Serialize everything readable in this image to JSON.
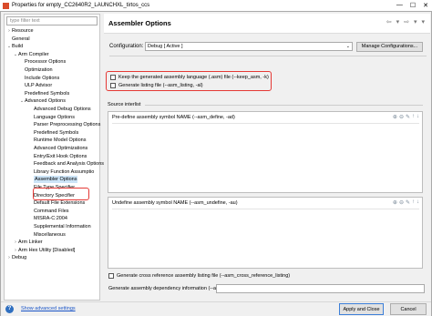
{
  "window": {
    "title": "Properties for empty_CC2640R2_LAUNCHXL_tirtos_ccs",
    "minimize": "—",
    "maximize": "☐",
    "close": "✕"
  },
  "filter": {
    "placeholder": "type filter text"
  },
  "tree": [
    {
      "label": "Resource",
      "twisty": "›",
      "level": 0
    },
    {
      "label": "General",
      "twisty": "",
      "level": 0
    },
    {
      "label": "Build",
      "twisty": "⌄",
      "level": 0
    },
    {
      "label": "Arm Compiler",
      "twisty": "⌄",
      "level": 1
    },
    {
      "label": "Processor Options",
      "twisty": "",
      "level": 2
    },
    {
      "label": "Optimization",
      "twisty": "",
      "level": 2
    },
    {
      "label": "Include Options",
      "twisty": "",
      "level": 2
    },
    {
      "label": "ULP Advisor",
      "twisty": "",
      "level": 2
    },
    {
      "label": "Predefined Symbols",
      "twisty": "",
      "level": 2
    },
    {
      "label": "Advanced Options",
      "twisty": "⌄",
      "level": 2
    },
    {
      "label": "Advanced Debug Options",
      "twisty": "",
      "level": 3
    },
    {
      "label": "Language Options",
      "twisty": "",
      "level": 3
    },
    {
      "label": "Parser Preprocessing Options",
      "twisty": "",
      "level": 3
    },
    {
      "label": "Predefined Symbols",
      "twisty": "",
      "level": 3
    },
    {
      "label": "Runtime Model Options",
      "twisty": "",
      "level": 3
    },
    {
      "label": "Advanced Optimizations",
      "twisty": "",
      "level": 3
    },
    {
      "label": "Entry/Exit Hook Options",
      "twisty": "",
      "level": 3
    },
    {
      "label": "Feedback and Analysis Options",
      "twisty": "",
      "level": 3
    },
    {
      "label": "Library Function Assumptio",
      "twisty": "",
      "level": 3
    },
    {
      "label": "Assembler Options",
      "twisty": "",
      "level": 3,
      "selected": true
    },
    {
      "label": "File Type Specifier",
      "twisty": "",
      "level": 3
    },
    {
      "label": "Directory Specifier",
      "twisty": "",
      "level": 3
    },
    {
      "label": "Default File Extensions",
      "twisty": "",
      "level": 3
    },
    {
      "label": "Command Files",
      "twisty": "",
      "level": 3
    },
    {
      "label": "MISRA-C:2004",
      "twisty": "",
      "level": 3
    },
    {
      "label": "Supplemental Information",
      "twisty": "",
      "level": 3
    },
    {
      "label": "Miscellaneous",
      "twisty": "",
      "level": 3
    },
    {
      "label": "Arm Linker",
      "twisty": "›",
      "level": 1
    },
    {
      "label": "Arm Hex Utility  [Disabled]",
      "twisty": "›",
      "level": 1
    },
    {
      "label": "Debug",
      "twisty": "›",
      "level": 0
    }
  ],
  "page": {
    "title": "Assembler Options",
    "nav_back": "⇦",
    "nav_menu": "▾",
    "nav_forward": "⇨",
    "nav_more": "▾",
    "nav_more2": "▾"
  },
  "configuration": {
    "label": "Configuration:",
    "value": "Debug  [ Active ]",
    "manage_label": "Manage Configurations..."
  },
  "options": {
    "keep_asm": "Keep the generated assembly language (.asm) file (--keep_asm, -k)",
    "gen_listing": "Generate listing file (--asm_listing, -al)",
    "source_interlist": "Source interlist",
    "predefine_header": "Pre-define assembly symbol NAME (--asm_define, -ad)",
    "undefine_header": "Undefine assembly symbol NAME (--asm_undefine, -au)",
    "cross_ref": "Generate cross reference assembly listing file (--asm_cross_reference_listing)",
    "dependency_label": "Generate assembly dependency information (--asm_dependency, -apd)"
  },
  "list_icons": [
    "⊕",
    "⊖",
    "✎",
    "↑",
    "↓"
  ],
  "bottom": {
    "help": "?",
    "advanced_link": "Show advanced settings",
    "apply_close": "Apply and Close",
    "cancel": "Cancel"
  }
}
